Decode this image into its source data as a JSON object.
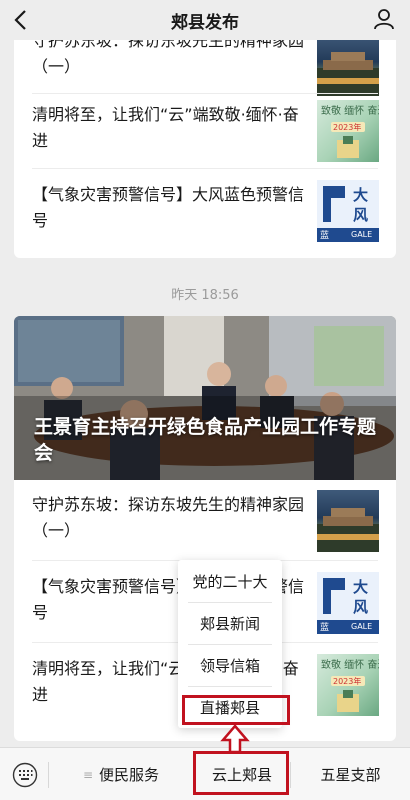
{
  "header": {
    "title": "郏县发布"
  },
  "top_card": {
    "items": [
      {
        "title": "守护苏东坡：探访东坡先生的精神家园（一）",
        "thumb": "city-icon"
      },
      {
        "title": "清明将至，让我们“云”端致敬·缅怀·奋进",
        "thumb": "qingming-icon"
      },
      {
        "title": "【气象灾害预警信号】大风蓝色预警信号",
        "thumb": "gale-warning-icon"
      }
    ]
  },
  "timestamp": "昨天 18:56",
  "cover": {
    "title": "王景育主持召开绿色食品产业园工作专题会"
  },
  "bottom_card": {
    "items": [
      {
        "title": "守护苏东坡：探访东坡先生的精神家园（一）",
        "thumb": "city-icon"
      },
      {
        "title": "【气象灾害预警信号】大风蓝色预警信号",
        "thumb": "gale-warning-icon"
      },
      {
        "title": "清明将至，让我们“云”端致敬·缅怀·奋进",
        "thumb": "qingming-icon"
      }
    ]
  },
  "gale": {
    "big": "大",
    "big2": "风",
    "small": "蓝",
    "en": "GALE"
  },
  "menu": {
    "items": [
      "党的二十大",
      "郏县新闻",
      "领导信箱",
      "直播郏县"
    ]
  },
  "tabs": [
    "便民服务",
    "云上郏县",
    "五星支部"
  ],
  "colors": {
    "highlight": "#c1121f",
    "gale_blue": "#1f4a8f"
  }
}
